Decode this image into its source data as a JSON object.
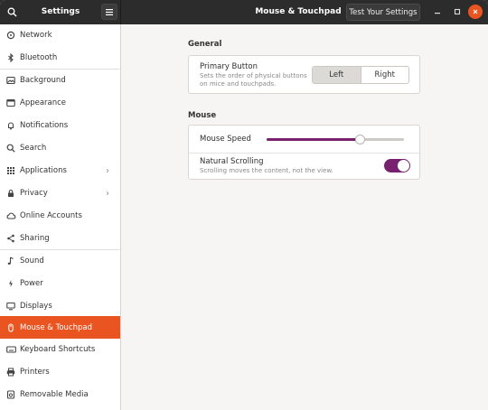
{
  "header": {
    "app_title": "Settings",
    "page_title": "Mouse & Touchpad",
    "test_button": "Test Your Settings"
  },
  "sidebar": {
    "items": [
      {
        "label": "Network",
        "icon": "network-icon"
      },
      {
        "label": "Bluetooth",
        "icon": "bluetooth-icon"
      },
      {
        "label": "Background",
        "icon": "background-icon"
      },
      {
        "label": "Appearance",
        "icon": "appearance-icon"
      },
      {
        "label": "Notifications",
        "icon": "bell-icon"
      },
      {
        "label": "Search",
        "icon": "search-icon"
      },
      {
        "label": "Applications",
        "icon": "applications-icon",
        "chevron": true
      },
      {
        "label": "Privacy",
        "icon": "privacy-icon",
        "chevron": true
      },
      {
        "label": "Online Accounts",
        "icon": "cloud-icon"
      },
      {
        "label": "Sharing",
        "icon": "share-icon"
      },
      {
        "label": "Sound",
        "icon": "music-note-icon"
      },
      {
        "label": "Power",
        "icon": "power-icon"
      },
      {
        "label": "Displays",
        "icon": "display-icon"
      },
      {
        "label": "Mouse & Touchpad",
        "icon": "mouse-icon",
        "active": true
      },
      {
        "label": "Keyboard Shortcuts",
        "icon": "keyboard-icon"
      },
      {
        "label": "Printers",
        "icon": "printer-icon"
      },
      {
        "label": "Removable Media",
        "icon": "removable-media-icon"
      }
    ]
  },
  "general": {
    "title": "General",
    "primary_button": {
      "label": "Primary Button",
      "description": "Sets the order of physical buttons on mice and touchpads.",
      "options": [
        "Left",
        "Right"
      ],
      "selected": "Left"
    }
  },
  "mouse": {
    "title": "Mouse",
    "speed": {
      "label": "Mouse Speed",
      "value_fraction": 0.68
    },
    "natural_scrolling": {
      "label": "Natural Scrolling",
      "description": "Scrolling moves the content, not the view.",
      "enabled": true
    }
  },
  "colors": {
    "accent": "#e95420",
    "toggle_on": "#77216f",
    "header_bg": "#2c2c2c"
  }
}
